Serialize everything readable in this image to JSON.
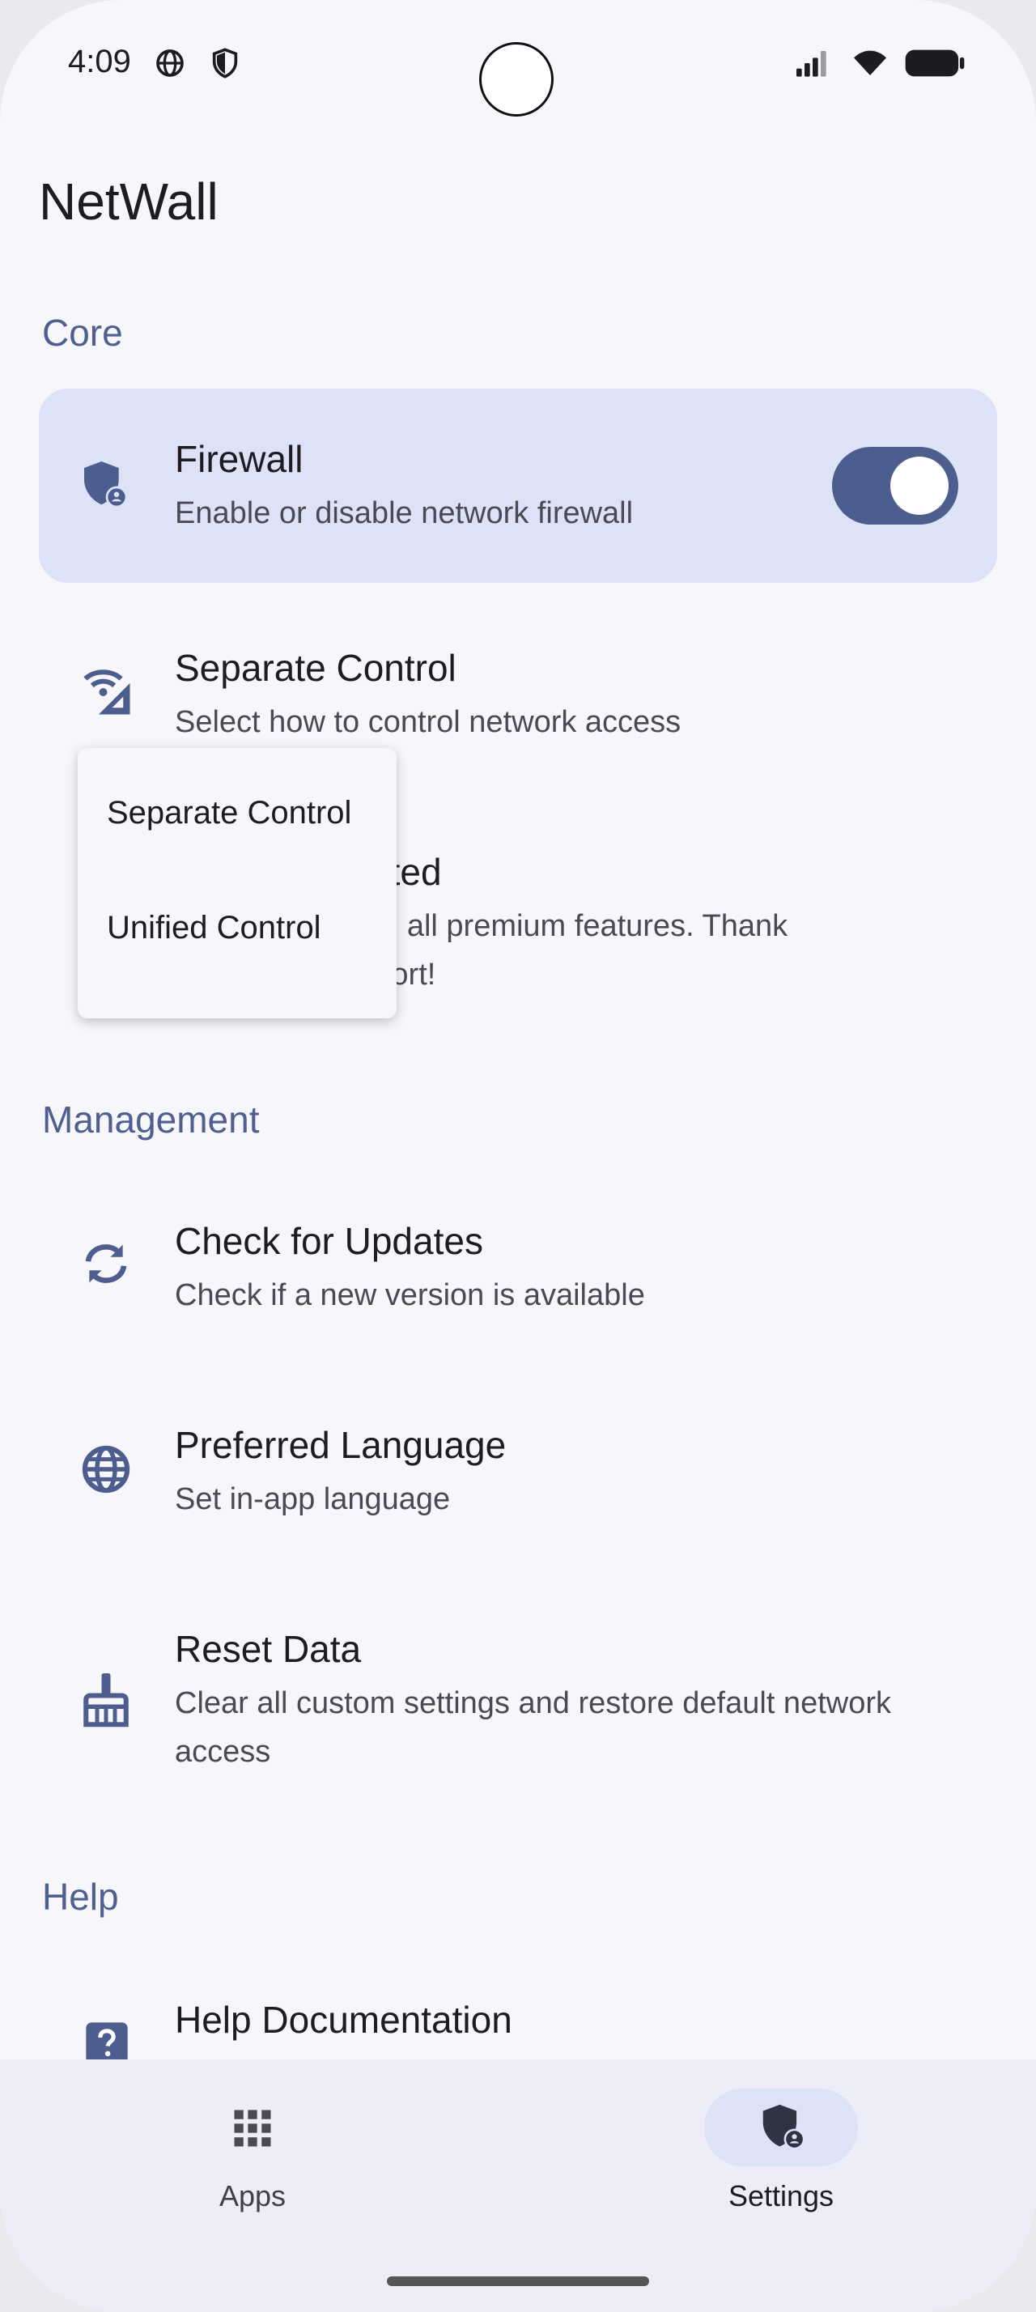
{
  "status_bar": {
    "time": "4:09"
  },
  "header": {
    "title": "NetWall"
  },
  "sections": {
    "core": "Core",
    "management": "Management",
    "help": "Help"
  },
  "rows": {
    "firewall": {
      "title": "Firewall",
      "subtitle": "Enable or disable network firewall",
      "enabled": true
    },
    "separate_control": {
      "title": "Separate Control",
      "subtitle": "Select how to control network access"
    },
    "premium": {
      "title_visible": "tivated",
      "subtitle_line1": "cked all premium features. Thank",
      "subtitle_line2": "upport!"
    },
    "check_updates": {
      "title": "Check for Updates",
      "subtitle": "Check if a new version is available"
    },
    "language": {
      "title": "Preferred Language",
      "subtitle": "Set in-app language"
    },
    "reset": {
      "title": "Reset Data",
      "subtitle": "Clear all custom settings and restore default network access"
    },
    "help_docs": {
      "title": "Help Documentation"
    }
  },
  "dropdown": {
    "options": [
      "Separate Control",
      "Unified Control"
    ]
  },
  "bottom_nav": {
    "items": [
      {
        "label": "Apps",
        "icon": "grid-icon",
        "selected": false
      },
      {
        "label": "Settings",
        "icon": "shield-user-icon",
        "selected": true
      }
    ]
  },
  "colors": {
    "accent": "#4d5e8e",
    "section_header": "#4f5f8f",
    "card_bg": "#dde2f6",
    "background": "#f7f6fb"
  }
}
